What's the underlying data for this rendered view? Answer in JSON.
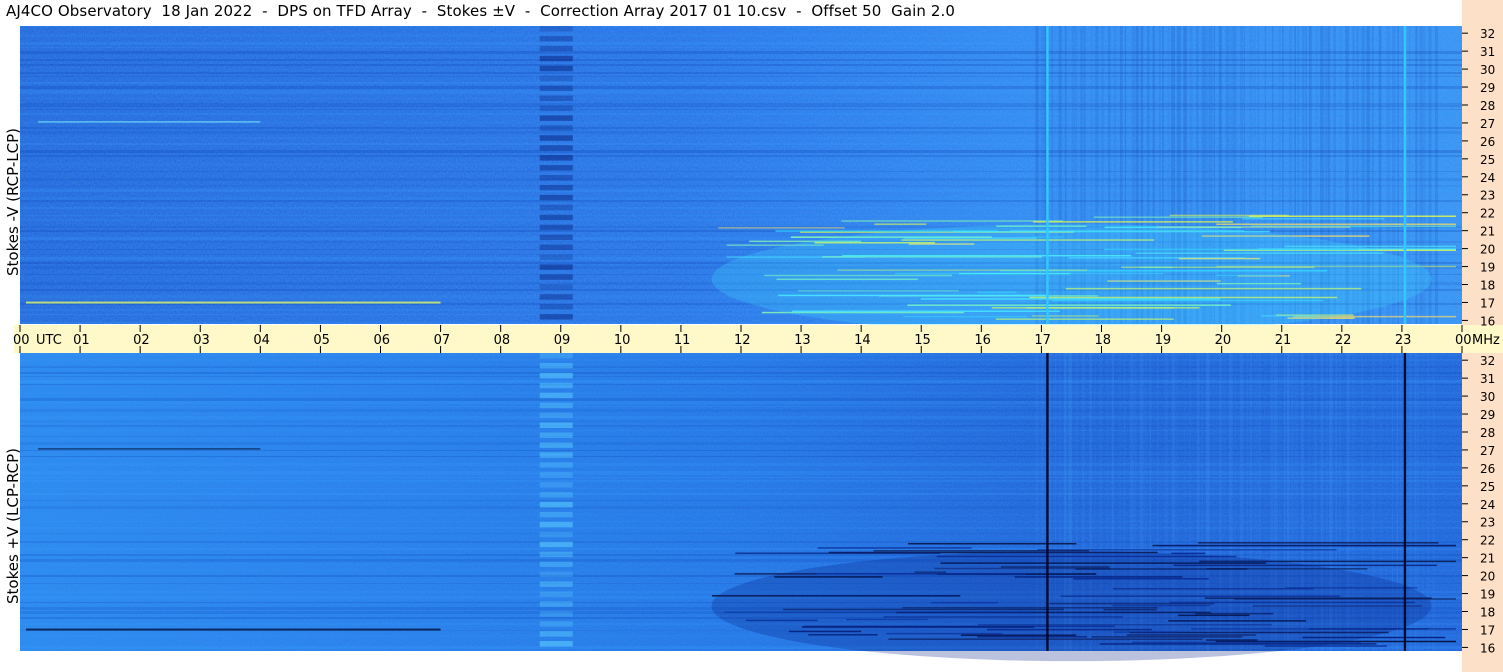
{
  "title": "AJ4CO Observatory  18 Jan 2022  -  DPS on TFD Array  -  Stokes ±V  -  Correction Array 2017 01 10.csv  -  Offset 50  Gain 2.0",
  "chart_data": [
    {
      "type": "heatmap",
      "panel": "top",
      "ylabel": "Stokes -V (RCP-LCP)",
      "x_unit": "UTC",
      "xlim": [
        0,
        24
      ],
      "y_unit": "MHz",
      "ylim": [
        15.8,
        32.4
      ],
      "y_ticks": [
        32,
        31,
        30,
        29,
        28,
        27,
        26,
        25,
        24,
        23,
        22,
        21,
        20,
        19,
        18,
        17,
        16
      ],
      "features": [
        {
          "kind": "vertical-line",
          "time_utc": 17.1,
          "color": "#33c8ff"
        },
        {
          "kind": "vertical-line",
          "time_utc": 23.05,
          "color": "#33c8ff"
        },
        {
          "kind": "dark-band",
          "time_utc_range": [
            8.6,
            9.2
          ]
        },
        {
          "kind": "bright-interference",
          "time_utc_range": [
            12,
            24
          ],
          "freq_mhz_range": [
            16,
            22
          ]
        }
      ]
    },
    {
      "type": "heatmap",
      "panel": "bottom",
      "ylabel": "Stokes +V (LCP-RCP)",
      "x_unit": "UTC",
      "xlim": [
        0,
        24
      ],
      "y_unit": "MHz",
      "ylim": [
        15.8,
        32.4
      ],
      "y_ticks": [
        32,
        31,
        30,
        29,
        28,
        27,
        26,
        25,
        24,
        23,
        22,
        21,
        20,
        19,
        18,
        17,
        16
      ],
      "features": [
        {
          "kind": "vertical-line",
          "time_utc": 17.1,
          "color": "#000a30"
        },
        {
          "kind": "vertical-line",
          "time_utc": 23.05,
          "color": "#000a30"
        },
        {
          "kind": "bright-band",
          "time_utc_range": [
            8.6,
            9.2
          ]
        },
        {
          "kind": "dark-interference",
          "time_utc_range": [
            12,
            24
          ],
          "freq_mhz_range": [
            16,
            22
          ]
        }
      ]
    }
  ],
  "x_axis": {
    "ticks": [
      "00",
      "01",
      "02",
      "03",
      "04",
      "05",
      "06",
      "07",
      "08",
      "09",
      "10",
      "11",
      "12",
      "13",
      "14",
      "15",
      "16",
      "17",
      "18",
      "19",
      "20",
      "21",
      "22",
      "23",
      "00"
    ],
    "start_label": "UTC",
    "end_label": "MHz"
  },
  "colors": {
    "background": "#1e6fe0",
    "axis_strip": "#fff8c8",
    "right_strip": "#fde0c8",
    "bright_line": "#33c8ff",
    "hot_line": "#f0ff40",
    "dark_line": "#000a30"
  }
}
